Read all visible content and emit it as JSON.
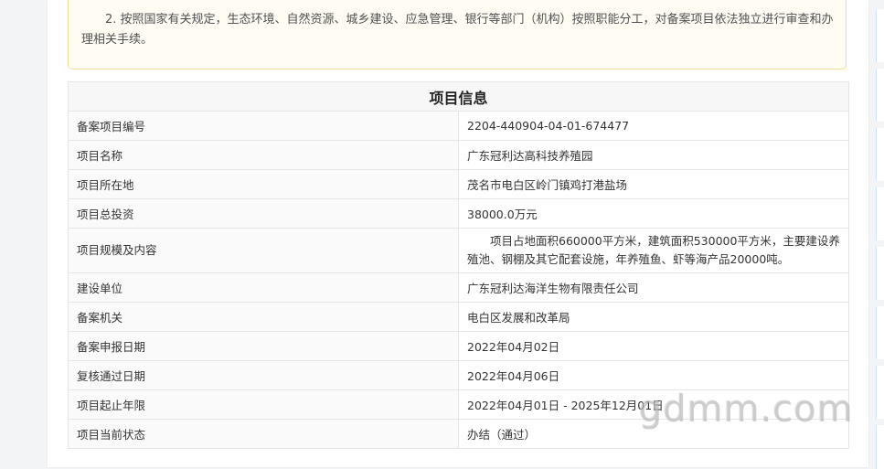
{
  "notice": {
    "text": "2. 按照国家有关规定，生态环境、自然资源、城乡建设、应急管理、银行等部门（机构）按照职能分工，对备案项目依法独立进行审查和办理相关手续。"
  },
  "table": {
    "title": "项目信息",
    "rows": [
      {
        "label": "备案项目编号",
        "value": "2204-440904-04-01-674477"
      },
      {
        "label": "项目名称",
        "value": "广东冠利达高科技养殖园"
      },
      {
        "label": "项目所在地",
        "value": "茂名市电白区岭门镇鸡打港盐场"
      },
      {
        "label": "项目总投资",
        "value": "38000.0万元"
      },
      {
        "label": "项目规模及内容",
        "value": "项目占地面积660000平方米，建筑面积530000平方米，主要建设养殖池、钢棚及其它配套设施，年养殖鱼、虾等海产品20000吨。"
      },
      {
        "label": "建设单位",
        "value": "广东冠利达海洋生物有限责任公司"
      },
      {
        "label": "备案机关",
        "value": "电白区发展和改革局"
      },
      {
        "label": "备案申报日期",
        "value": "2022年04月02日"
      },
      {
        "label": "复核通过日期",
        "value": "2022年04月06日"
      },
      {
        "label": "项目起止年限",
        "value": "2022年04月01日 - 2025年12月01日"
      },
      {
        "label": "项目当前状态",
        "value": "办结（通过）"
      }
    ]
  },
  "watermark": "gdmm.com"
}
